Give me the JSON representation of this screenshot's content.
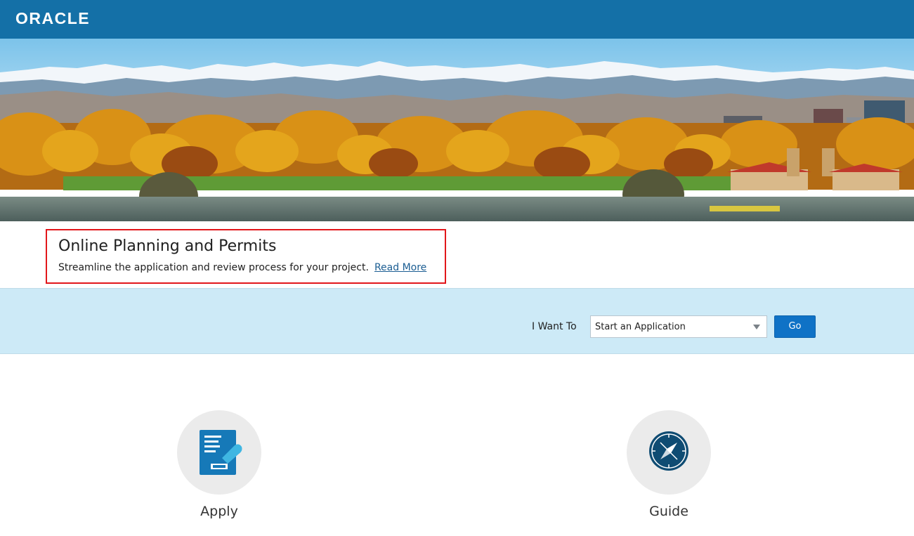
{
  "header": {
    "logo_text": "ORACLE",
    "bg_color": "#1470a7"
  },
  "hero": {
    "description": "landscape-banner"
  },
  "intro": {
    "title": "Online Planning and Permits",
    "description": "Streamline the application and review process for your project.",
    "read_more_label": "Read More",
    "highlight_color": "#e2171b"
  },
  "want_to": {
    "label": "I Want To",
    "selected_option": "Start an Application",
    "go_label": "Go",
    "band_color": "#cdeaf7",
    "button_color": "#0f72c6"
  },
  "tiles": [
    {
      "label": "Apply",
      "icon": "application-stamp-icon"
    },
    {
      "label": "Guide",
      "icon": "compass-icon"
    }
  ]
}
